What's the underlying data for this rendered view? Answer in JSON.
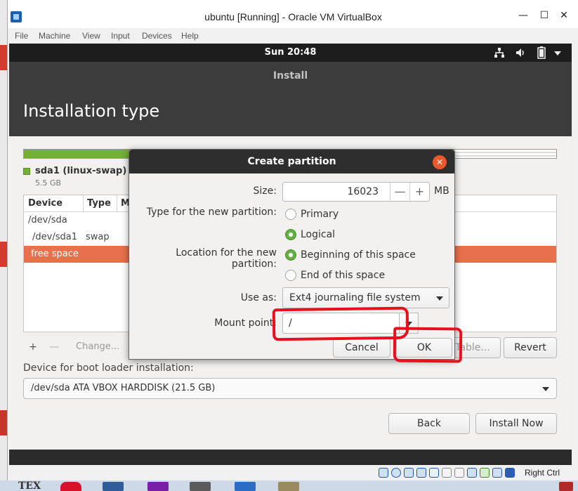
{
  "window": {
    "title": "ubuntu [Running] - Oracle VM VirtualBox",
    "minimize_glyph": "—",
    "maximize_glyph": "☐",
    "close_glyph": "✕"
  },
  "menu": [
    "File",
    "Machine",
    "View",
    "Input",
    "Devices",
    "Help"
  ],
  "topbar": {
    "clock": "Sun 20:48",
    "indicators": [
      "network-icon",
      "volume-icon",
      "battery-icon",
      "menu-caret-icon"
    ]
  },
  "installer": {
    "app_title": "Install",
    "page_title": "Installation type",
    "legend": {
      "name": "sda1 (linux-swap)",
      "size": "5.5 GB",
      "color": "#73b036"
    },
    "table": {
      "headers": [
        "Device",
        "Type",
        "M"
      ],
      "rows": [
        {
          "device": "/dev/sda",
          "type": ""
        },
        {
          "device": "/dev/sda1",
          "type": "swap"
        },
        {
          "device": "free space",
          "type": ""
        }
      ]
    },
    "toolbar": {
      "add": "+",
      "remove": "—",
      "change": "Change..."
    },
    "partial_button": "Table...",
    "revert": "Revert",
    "boot_label": "Device for boot loader installation:",
    "boot_device": "/dev/sda   ATA VBOX HARDDISK (21.5 GB)",
    "back": "Back",
    "install_now": "Install Now",
    "accent_color": "#e9704c"
  },
  "dialog": {
    "title": "Create partition",
    "close_glyph": "✕",
    "size_label": "Size:",
    "size_value": "16023",
    "size_unit": "MB",
    "minus": "—",
    "plus": "+",
    "type_label": "Type for the new partition:",
    "type_primary": "Primary",
    "type_logical": "Logical",
    "location_label": "Location for the new partition:",
    "location_begin": "Beginning of this space",
    "location_end": "End of this space",
    "use_as_label": "Use as:",
    "use_as_value": "Ext4 journaling file system",
    "mount_label": "Mount point:",
    "mount_value": "/",
    "cancel": "Cancel",
    "ok": "OK"
  },
  "statusbar": {
    "host_key": "Right Ctrl"
  },
  "taskbar": {
    "tex_label": "TEX"
  },
  "annotation_color": "#e8101e"
}
